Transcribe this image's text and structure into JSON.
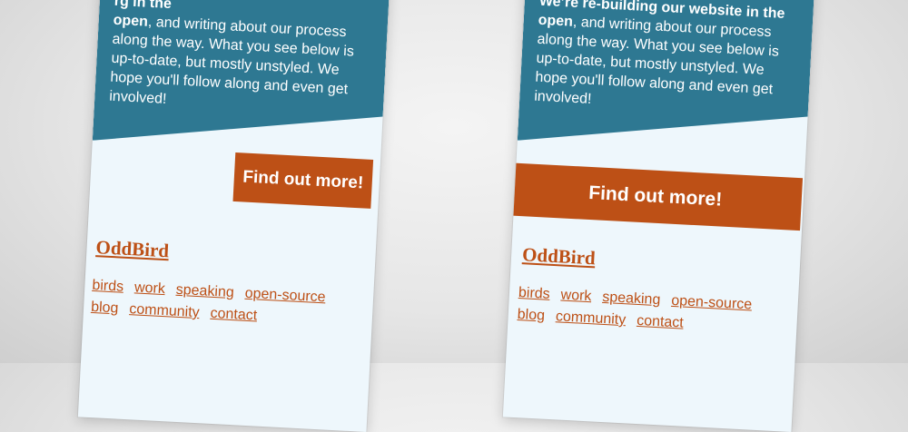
{
  "views": [
    {
      "intro_bold_fragment": "rg in the",
      "intro_bold_end": "open",
      "intro_text": ", and writing about our process along the way. What you see below is up-to-date, but mostly unstyled. We hope you'll follow along and even get involved!",
      "cta_label": "Find out more!",
      "brand": "OddBird",
      "nav": [
        "birds",
        "work",
        "speaking",
        "open-source",
        "blog",
        "community",
        "contact"
      ]
    },
    {
      "intro_bold_fragment": "We’re re-building our website in the",
      "intro_bold_end": "open",
      "intro_text": ", and writing about our process along the way. What you see below is up-to-date, but mostly unstyled. We hope you'll follow along and even get involved!",
      "cta_label": "Find out more!",
      "brand": "OddBird",
      "nav": [
        "birds",
        "work",
        "speaking",
        "open-source",
        "blog",
        "community",
        "contact"
      ]
    }
  ],
  "colors": {
    "hero": "#2e7892",
    "accent": "#bd5016",
    "panel": "#eef7fc"
  }
}
